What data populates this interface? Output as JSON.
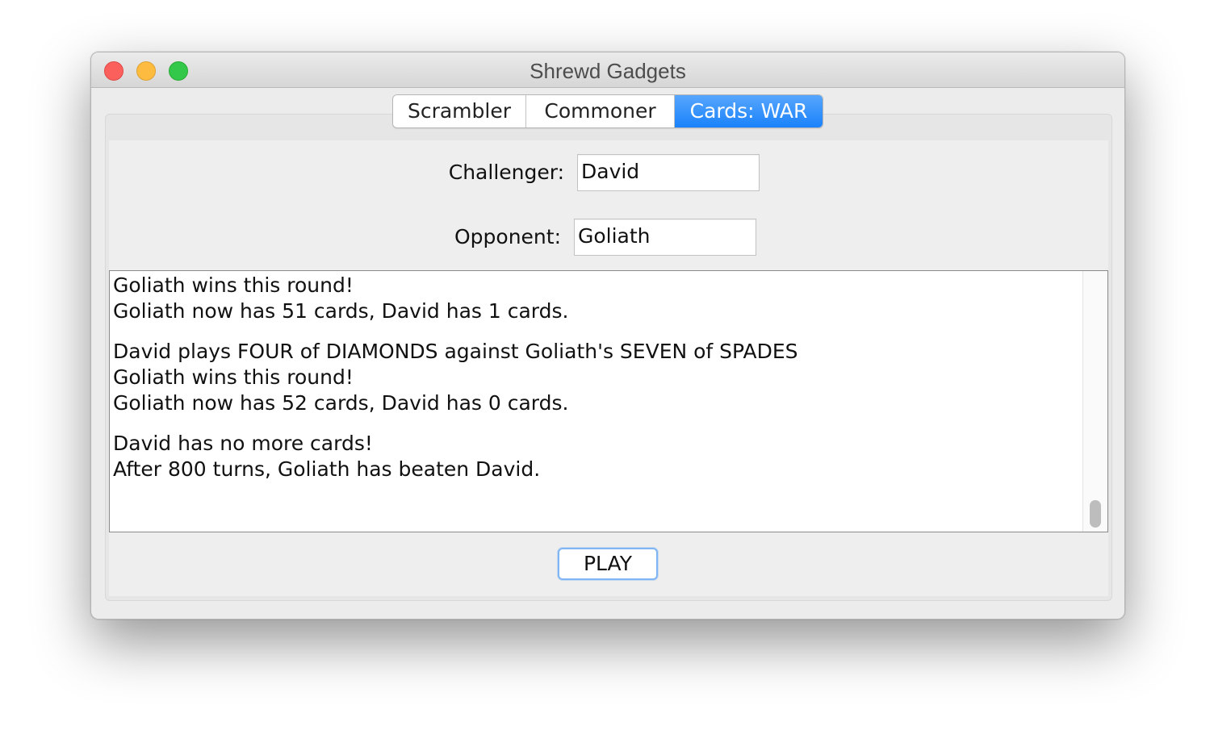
{
  "window": {
    "title": "Shrewd Gadgets"
  },
  "tabs": [
    {
      "label": "Scrambler",
      "selected": false
    },
    {
      "label": "Commoner",
      "selected": false
    },
    {
      "label": "Cards: WAR",
      "selected": true
    }
  ],
  "form": {
    "challenger_label": "Challenger:",
    "challenger_value": "David",
    "opponent_label": "Opponent:",
    "opponent_value": "Goliath"
  },
  "log": {
    "lines": [
      "Goliath wins this round!",
      "Goliath now has 51 cards, David has 1 cards.",
      "",
      "David plays FOUR of DIAMONDS against Goliath's SEVEN of SPADES",
      "Goliath wins this round!",
      "Goliath now has 52 cards, David has 0 cards.",
      "",
      "David has no more cards!",
      "After 800 turns, Goliath has beaten David."
    ]
  },
  "actions": {
    "play_label": "PLAY"
  },
  "colors": {
    "accent": "#1a82fb",
    "close": "#fc605c",
    "minimize": "#fdbc40",
    "maximize": "#34c84a"
  }
}
